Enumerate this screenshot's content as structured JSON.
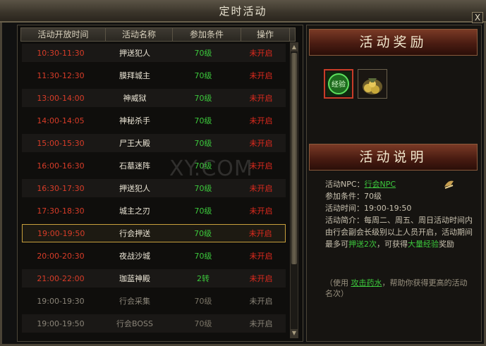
{
  "window": {
    "title": "定时活动",
    "close_label": "X"
  },
  "table": {
    "headers": [
      "活动开放时间",
      "活动名称",
      "参加条件",
      "操作"
    ],
    "rows": [
      {
        "time": "10:30-11:30",
        "name": "押送犯人",
        "level": "70级",
        "status": "未开启"
      },
      {
        "time": "11:30-12:30",
        "name": "膜拜城主",
        "level": "70级",
        "status": "未开启"
      },
      {
        "time": "13:00-14:00",
        "name": "神威狱",
        "level": "70级",
        "status": "未开启"
      },
      {
        "time": "14:00-14:05",
        "name": "神秘杀手",
        "level": "70级",
        "status": "未开启"
      },
      {
        "time": "15:00-15:30",
        "name": "尸王大殿",
        "level": "70级",
        "status": "未开启"
      },
      {
        "time": "16:00-16:30",
        "name": "石墓迷阵",
        "level": "70级",
        "status": "未开启"
      },
      {
        "time": "16:30-17:30",
        "name": "押送犯人",
        "level": "70级",
        "status": "未开启"
      },
      {
        "time": "17:30-18:30",
        "name": "城主之刃",
        "level": "70级",
        "status": "未开启"
      },
      {
        "time": "19:00-19:50",
        "name": "行会押送",
        "level": "70级",
        "status": "未开启"
      },
      {
        "time": "20:00-20:30",
        "name": "夜战沙城",
        "level": "70级",
        "status": "未开启"
      },
      {
        "time": "21:00-22:00",
        "name": "珈蓝神殿",
        "level": "2转",
        "status": "未开启"
      },
      {
        "time": "19:00-19:30",
        "name": "行会采集",
        "level": "70级",
        "status": "未开启"
      },
      {
        "time": "19:00-19:50",
        "name": "行会BOSS",
        "level": "70级",
        "status": "未开启"
      }
    ]
  },
  "reward": {
    "title": "活动奖励",
    "items": [
      "经验",
      "金币"
    ]
  },
  "desc": {
    "title": "活动说明",
    "npc_label": "活动NPC：",
    "npc_link": "行会NPC",
    "cond_label": "参加条件：",
    "cond_value": "70级",
    "time_label": "活动时间：",
    "time_value": "19:00-19:50",
    "intro_label": "活动简介：",
    "intro_a": "每周二、周五、周日活动时间内由行会副会长级别以上人员开启，活动期间最多可",
    "intro_b": "押送2次",
    "intro_c": "，可获得",
    "intro_d": "大量经验",
    "intro_e": "奖励",
    "note_a": "（使用 ",
    "note_link": "攻击药水",
    "note_b": "，帮助你获得更高的活动名次）"
  },
  "watermark": {
    "text": "XY.COM"
  }
}
